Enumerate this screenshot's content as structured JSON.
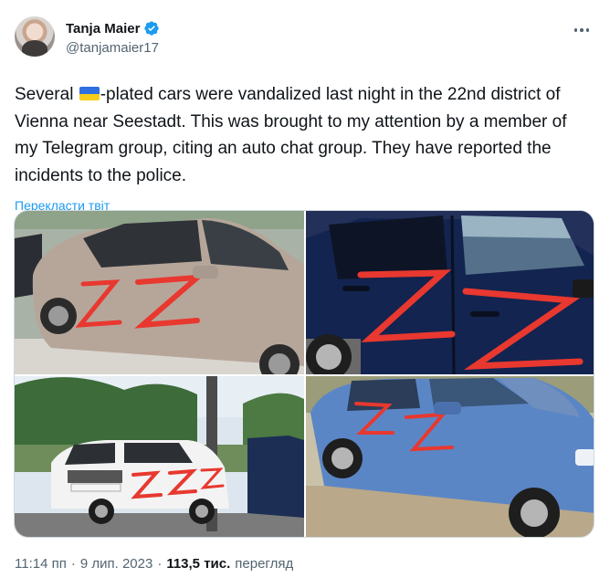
{
  "author": {
    "display_name": "Tanja Maier",
    "handle": "@tanjamaier17",
    "verified": true
  },
  "tweet": {
    "text_before_flag": "Several ",
    "flag_icon": "ukraine-flag-icon",
    "text_after_flag": "-plated cars were vandalized last night in the 22nd district of Vienna near Seestadt. This was brought to my attention by a member of my Telegram group, citing an auto chat group. They have reported the incidents to the police.",
    "translate_label": "Перекласти твіт"
  },
  "media": {
    "photos": [
      {
        "icon": "photo-beige-hatchback-z"
      },
      {
        "icon": "photo-blue-suv-z"
      },
      {
        "icon": "photo-white-suv-z"
      },
      {
        "icon": "photo-light-blue-suv-z"
      }
    ]
  },
  "footer": {
    "time": "11:14 пп",
    "separator": "·",
    "date": "9 лип. 2023",
    "separator2": "·",
    "views_count": "113,5 тис.",
    "views_label": "перегляд"
  },
  "colors": {
    "accent": "#1d9bf0",
    "secondary_text": "#536471",
    "verified_badge": "#1d9bf0",
    "z_paint": "#e8382f"
  }
}
